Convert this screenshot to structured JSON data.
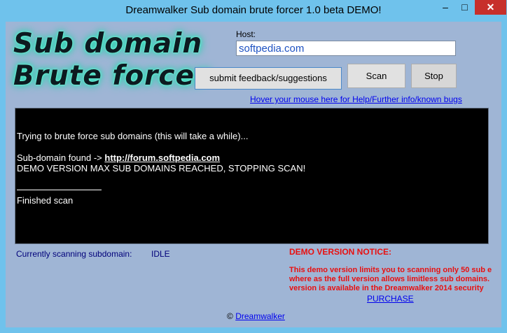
{
  "window": {
    "title": "Dreamwalker Sub domain brute forcer 1.0 beta DEMO!",
    "minimize": "–",
    "maximize": "□",
    "close": "✕"
  },
  "logo": {
    "line1": "Sub domain",
    "line2": "Brute forcer"
  },
  "host": {
    "label": "Host:",
    "value": "softpedia.com"
  },
  "buttons": {
    "feedback": "submit feedback/suggestions",
    "scan": "Scan",
    "stop": "Stop"
  },
  "help_link": "Hover your mouse here for Help/Further info/known bugs",
  "console": {
    "line1": "Trying to brute force sub domains (this will take a while)...",
    "found_prefix": "Sub-domain found -> ",
    "found_url": "http://forum.softpedia.com",
    "line3": "DEMO VERSION MAX SUB DOMAINS REACHED, STOPPING SCAN!",
    "line4": "Finished scan"
  },
  "status": {
    "label": "Currently scanning subdomain:",
    "value": "IDLE"
  },
  "demo_notice": {
    "title": "DEMO VERSION NOTICE:",
    "line1": "This demo version limits you to scanning only 50 sub e",
    "line2": "where as the full version allows limitless sub domains.",
    "line3": "version is available in the Dreamwalker 2014 security",
    "purchase": "PURCHASE"
  },
  "footer": {
    "copyright_symbol": "©",
    "author": "Dreamwalker"
  }
}
